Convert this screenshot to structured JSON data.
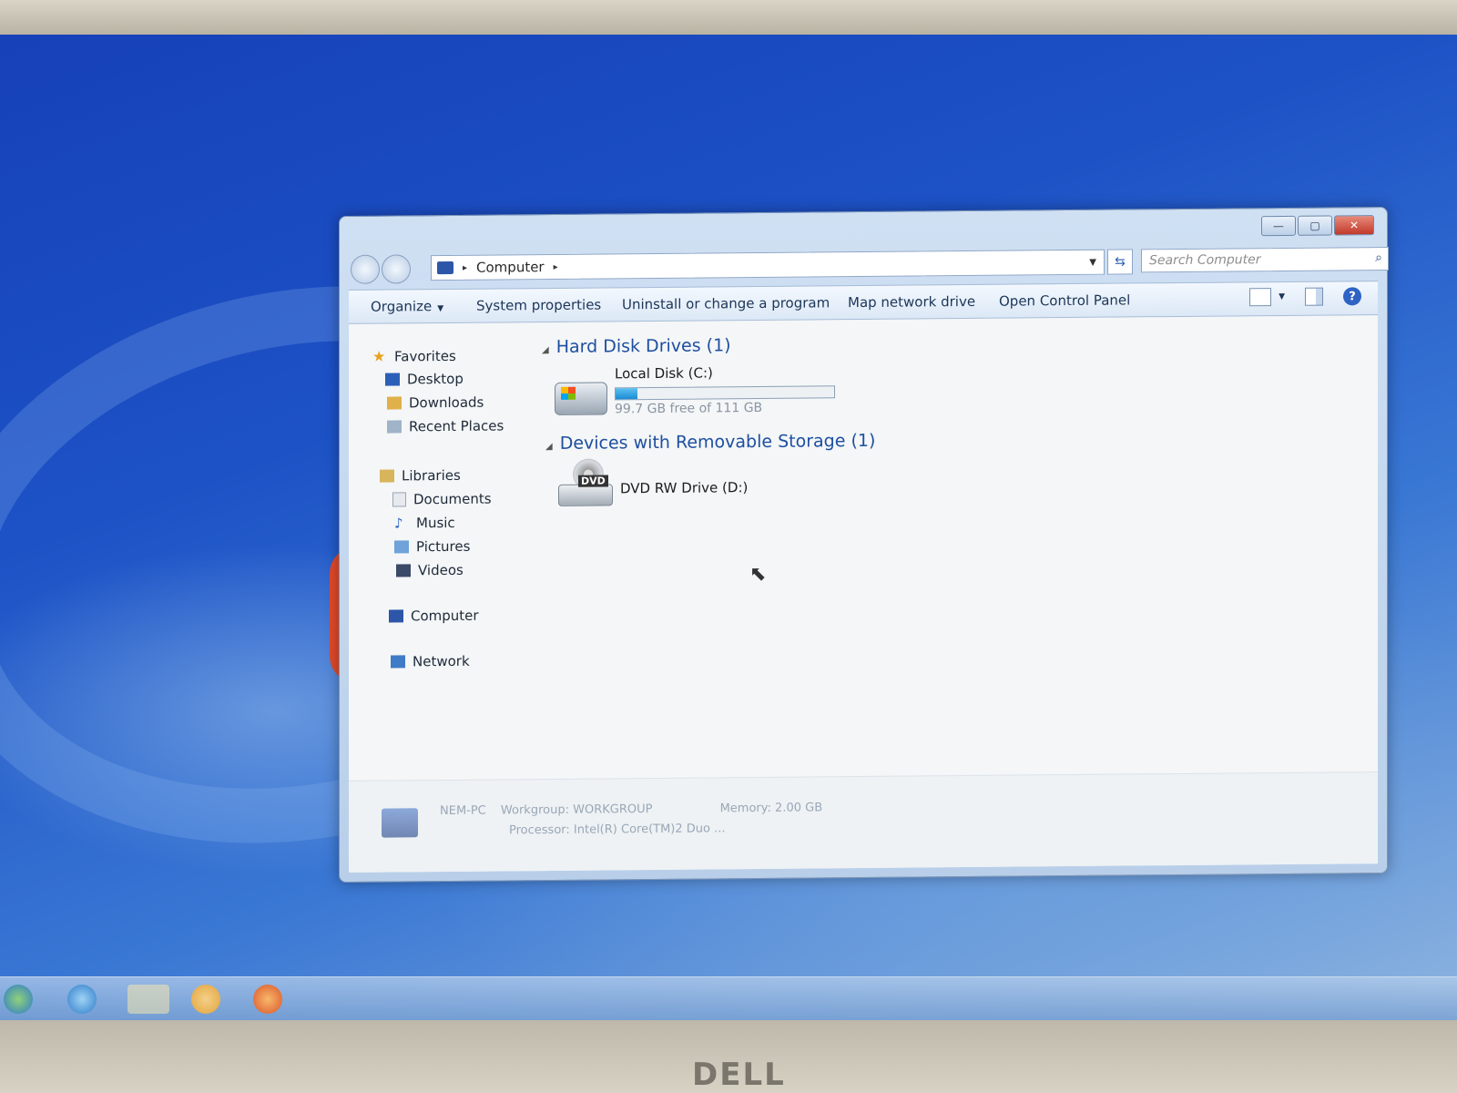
{
  "window": {
    "controls": {
      "minimize": "—",
      "maximize": "▢",
      "close": "✕"
    }
  },
  "address_bar": {
    "crumb": "Computer",
    "separator": "▸",
    "dropdown": "▼",
    "refresh": "⇆"
  },
  "search": {
    "placeholder": "Search Computer",
    "icon": "⌕"
  },
  "command_bar": {
    "organize": "Organize",
    "organize_caret": "▼",
    "system_properties": "System properties",
    "uninstall": "Uninstall or change a program",
    "map_drive": "Map network drive",
    "control_panel": "Open Control Panel",
    "views_caret": "▼",
    "help": "?"
  },
  "nav_pane": {
    "favorites": "Favorites",
    "desktop": "Desktop",
    "downloads": "Downloads",
    "recent_places": "Recent Places",
    "libraries": "Libraries",
    "documents": "Documents",
    "music": "Music",
    "pictures": "Pictures",
    "videos": "Videos",
    "computer": "Computer",
    "network": "Network"
  },
  "content": {
    "hard_disk_header": "Hard Disk Drives (1)",
    "removable_header": "Devices with Removable Storage (1)",
    "collapse_glyph": "◢",
    "local_disk": {
      "name": "Local Disk (C:)",
      "free_text": "99.7 GB free of 111 GB",
      "used_fraction": 0.102
    },
    "dvd": {
      "name": "DVD RW Drive (D:)",
      "label": "DVD"
    }
  },
  "details_pane": {
    "computer_name": "NEM-PC",
    "workgroup_label": "Workgroup:",
    "workgroup": "WORKGROUP",
    "memory_label": "Memory:",
    "memory": "2.00 GB",
    "processor_label": "Processor:",
    "processor": "Intel(R) Core(TM)2 Duo ..."
  },
  "bezel": {
    "brand": "DELL"
  },
  "colors": {
    "accent": "#1e4fa0",
    "disk_fill": "#1b8bd4",
    "close_button": "#c0392b"
  }
}
